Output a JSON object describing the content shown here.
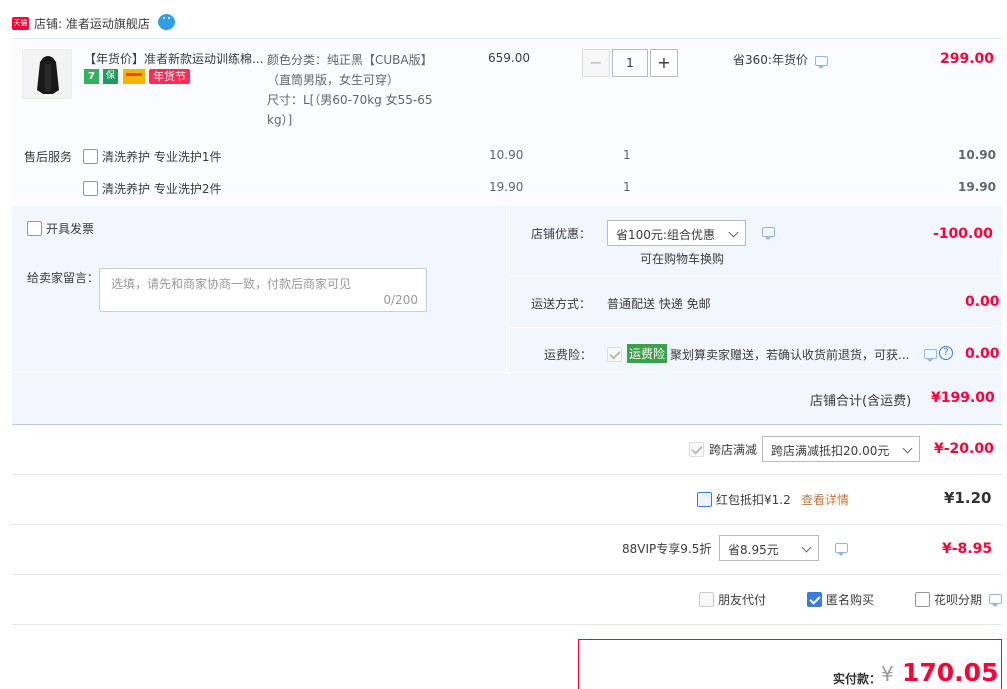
{
  "shop": {
    "badge": "天猫",
    "label": "店铺: 准者运动旗舰店"
  },
  "product": {
    "title": "【年货价】准者新款运动训练棉...",
    "tag_nianhuo": "年货节",
    "color_spec": "颜色分类：纯正黑【CUBA版】",
    "color_spec2": "（直筒男版，女生可穿）",
    "size_spec": "尺寸：L[（男60-70kg 女55-65",
    "size_spec2": "kg）]",
    "unit_price": "659.00",
    "quantity": "1",
    "minus": "−",
    "plus": "+",
    "promo": "省360:年货价",
    "subtotal": "299.00"
  },
  "after_sale": {
    "label": "售后服务",
    "items": [
      {
        "name": "清洗养护 专业洗护1件",
        "price": "10.90",
        "qty": "1",
        "total": "10.90"
      },
      {
        "name": "清洗养护 专业洗护2件",
        "price": "19.90",
        "qty": "1",
        "total": "19.90"
      }
    ]
  },
  "order_options": {
    "invoice_label": "开具发票",
    "note_label": "给卖家留言：",
    "note_placeholder": "选填，请先和商家协商一致，付款后商家可见",
    "note_counter": "0/200",
    "shop_discount_label": "店铺优惠：",
    "shop_discount_value": "省100元:组合优惠",
    "shop_discount_hint": "可在购物车换购",
    "shop_discount_amount": "-100.00",
    "shipping_label": "运送方式：",
    "shipping_value": "普通配送 快递 免邮",
    "shipping_amount": "0.00",
    "insurance_label": "运费险：",
    "insurance_badge": "运费险",
    "insurance_text": "聚划算卖家赠送，若确认收货前退货，可获...",
    "insurance_amount": "0.00",
    "shop_total_label": "店铺合计(含运费)",
    "shop_total_amount": "¥199.00"
  },
  "cross_store": {
    "label": "跨店满减",
    "select": "跨店满减抵扣20.00元",
    "amount": "¥-20.00"
  },
  "red_packet": {
    "label": "红包抵扣¥1.2",
    "link": "查看详情",
    "amount": "¥1.20"
  },
  "vip": {
    "label": "88VIP专享9.5折",
    "select": "省8.95元",
    "amount": "¥-8.95"
  },
  "extras": {
    "friend_pay": "朋友代付",
    "anonymous": "匿名购买",
    "huabei": "花呗分期"
  },
  "payment": {
    "label": "实付款：",
    "currency": "¥",
    "amount": "170.05"
  },
  "colors": {
    "accent_red": "#ff0036",
    "band_blue": "#f2f7ff",
    "checkbox_blue": "#3a7be0",
    "insurance_green": "#3aa24a"
  }
}
